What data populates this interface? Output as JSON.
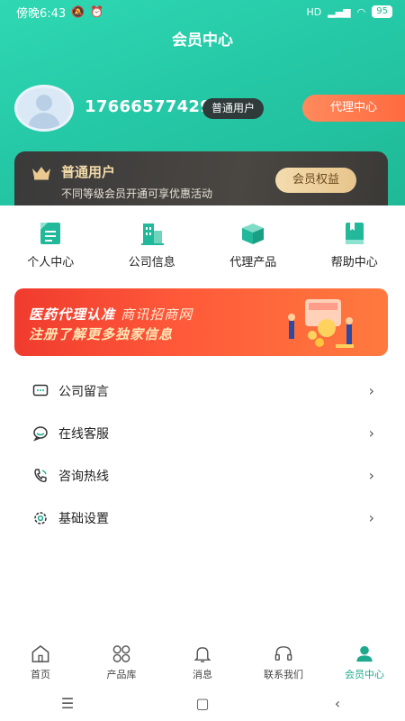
{
  "status_bar": {
    "time": "傍晚6:43",
    "network": "HD",
    "battery": "95"
  },
  "header": {
    "title": "会员中心"
  },
  "profile": {
    "phone": "17666577429",
    "user_type": "普通用户",
    "agent_button": "代理中心"
  },
  "vip_card": {
    "title": "普通用户",
    "description": "不同等级会员开通可享优惠活动",
    "benefit_button": "会员权益"
  },
  "grid": [
    {
      "label": "个人中心",
      "icon": "document-icon"
    },
    {
      "label": "公司信息",
      "icon": "building-icon"
    },
    {
      "label": "代理产品",
      "icon": "box-icon"
    },
    {
      "label": "帮助中心",
      "icon": "book-icon"
    }
  ],
  "banner": {
    "line1_a": "医药代理认准",
    "line1_b": "商讯招商网",
    "line2": "注册了解更多独家信息"
  },
  "menu": [
    {
      "label": "公司留言",
      "icon": "chat-icon"
    },
    {
      "label": "在线客服",
      "icon": "customer-service-icon"
    },
    {
      "label": "咨询热线",
      "icon": "phone-icon"
    },
    {
      "label": "基础设置",
      "icon": "gear-icon"
    }
  ],
  "tabs": [
    {
      "label": "首页",
      "icon": "home-icon"
    },
    {
      "label": "产品库",
      "icon": "grid-icon"
    },
    {
      "label": "消息",
      "icon": "bell-icon"
    },
    {
      "label": "联系我们",
      "icon": "headset-icon"
    },
    {
      "label": "会员中心",
      "icon": "user-icon",
      "active": true
    }
  ],
  "colors": {
    "primary": "#22c4a2",
    "accent_orange": "#ff6a40",
    "vip_gold": "#f1d9a8"
  }
}
